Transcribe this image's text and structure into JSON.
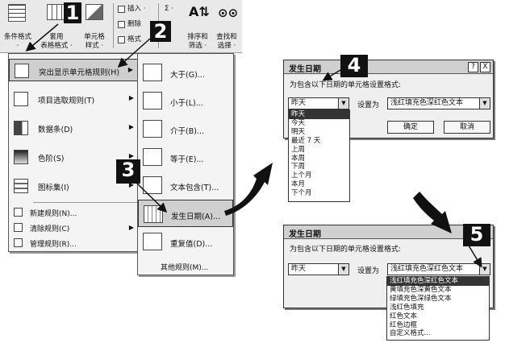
{
  "ribbon": {
    "cond_format": {
      "label1": "条件格式",
      "label2": "·"
    },
    "table_format": {
      "label1": "套用",
      "label2": "表格格式 ·"
    },
    "cell_style": {
      "label1": "单元格",
      "label2": "样式 ·"
    },
    "insert": "插入 ·",
    "delete": "删除",
    "format": "格式",
    "sigma": "Σ ·",
    "sort": {
      "label1": "排序和",
      "label2": "筛选 ·"
    },
    "find": {
      "label1": "查找和",
      "label2": "选择 ·"
    }
  },
  "menu1": {
    "items": [
      {
        "label": "突出显示单元格规则(H)",
        "arrow": "▶"
      },
      {
        "label": "项目选取规则(T)",
        "arrow": "▶"
      },
      {
        "label": "数据条(D)",
        "arrow": "▶"
      },
      {
        "label": "色阶(S)",
        "arrow": "▶"
      },
      {
        "label": "图标集(I)",
        "arrow": "▶"
      }
    ],
    "small_items": [
      "新建规则(N)...",
      "清除规则(C)",
      "管理规则(R)..."
    ],
    "small_arrow": "▶"
  },
  "menu2": {
    "items": [
      "大于(G)...",
      "小于(L)...",
      "介于(B)...",
      "等于(E)...",
      "文本包含(T)...",
      "发生日期(A)...",
      "重复值(D)..."
    ],
    "other": "其他规则(M)..."
  },
  "dialog1": {
    "title": "发生日期",
    "help": "?",
    "close": "X",
    "prompt": "为包含以下日期的单元格设置格式:",
    "date_value": "昨天",
    "set_as": "设置为",
    "format_value": "浅红填充色深红色文本",
    "ok": "确定",
    "cancel": "取消",
    "date_options": [
      "昨天",
      "今天",
      "明天",
      "最近 7 天",
      "上周",
      "本周",
      "下周",
      "上个月",
      "本月",
      "下个月"
    ]
  },
  "dialog2": {
    "title": "发生日期",
    "help": "?",
    "close": "X",
    "prompt": "为包含以下日期的单元格设置格式:",
    "date_value": "昨天",
    "set_as": "设置为",
    "format_value": "浅红填充色深红色文本",
    "format_options": [
      "浅红填充色深红色文本",
      "黄填充色深黄色文本",
      "绿填充色深绿色文本",
      "浅红色填充",
      "红色文本",
      "红色边框",
      "自定义格式..."
    ]
  },
  "badges": [
    "1",
    "2",
    "3",
    "4",
    "5"
  ],
  "dropdown_arrow": "▼"
}
